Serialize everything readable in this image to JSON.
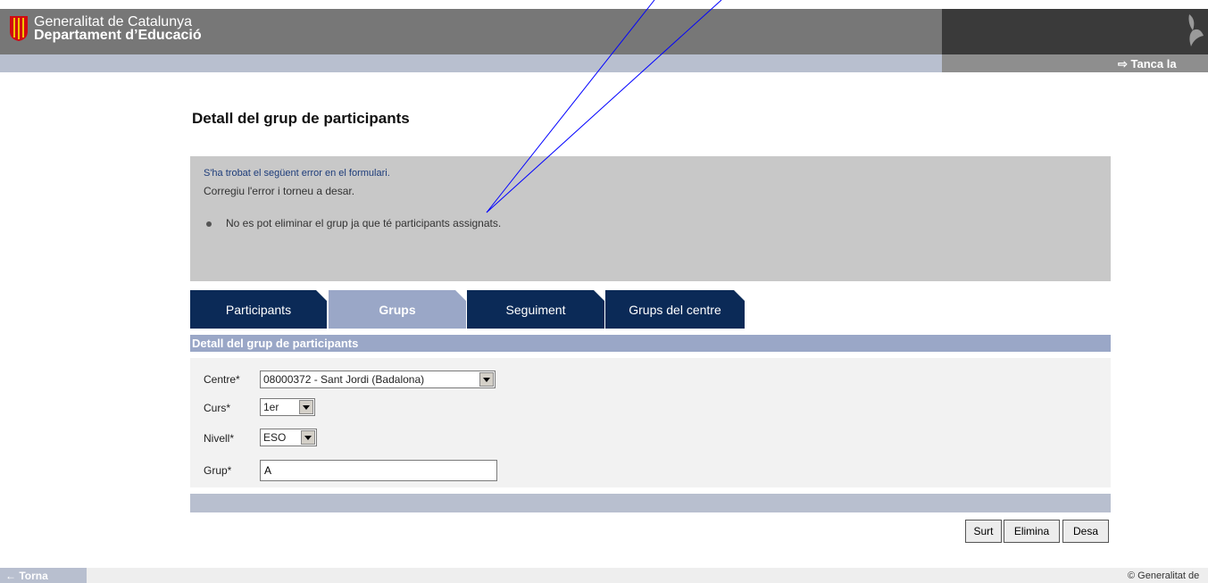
{
  "header": {
    "org_name": "Generalitat de Catalunya",
    "dept_name": "Departament d’Educació",
    "logout_label": "Tanca la"
  },
  "page": {
    "title": "Detall del grup de participants"
  },
  "error": {
    "heading": "S'ha trobat el següent error en el formulari.",
    "instruction": "Corregiu l'error i torneu a desar.",
    "messages": [
      "No es pot eliminar el grup ja que té participants assignats."
    ]
  },
  "tabs": [
    {
      "label": "Participants",
      "active": false
    },
    {
      "label": "Grups",
      "active": true
    },
    {
      "label": "Seguiment",
      "active": false
    },
    {
      "label": "Grups del centre",
      "active": false
    }
  ],
  "form": {
    "section_title": "Detall del grup de participants",
    "centre": {
      "label": "Centre*",
      "value": "08000372 - Sant Jordi (Badalona)"
    },
    "curs": {
      "label": "Curs*",
      "value": "1er"
    },
    "nivell": {
      "label": "Nivell*",
      "value": "ESO"
    },
    "grup": {
      "label": "Grup*",
      "value": "A"
    }
  },
  "buttons": {
    "surt": "Surt",
    "elimina": "Elimina",
    "desa": "Desa"
  },
  "footer": {
    "back_label": "← Torna",
    "copyright": "© Generalitat de"
  },
  "colors": {
    "header": "#777777",
    "tab_active": "#9aa7c7",
    "tab_inactive": "#0b2a57",
    "error_box": "#c8c8c8",
    "annotation": "#0000ff"
  }
}
